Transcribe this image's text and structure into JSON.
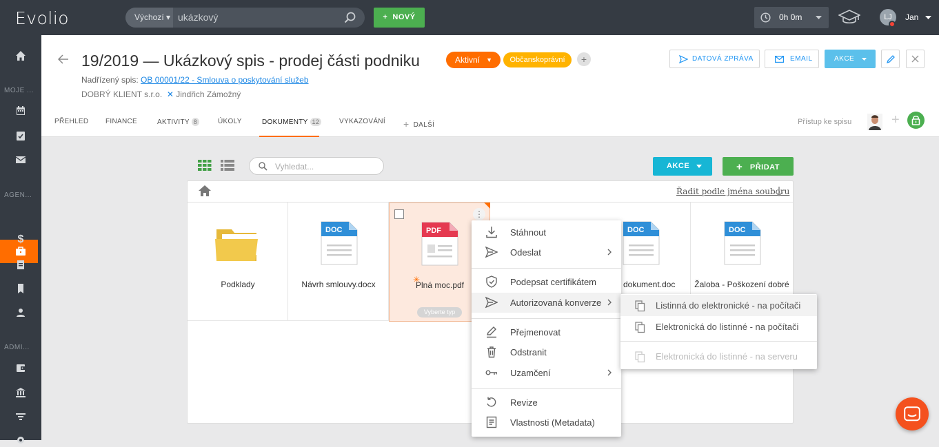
{
  "topbar": {
    "logo": "Evolio",
    "search_scope": "Výchozí",
    "search_value": "ukázkový",
    "new_button": "NOVÝ",
    "timer": "0h 0m",
    "user_initials": "LJ",
    "user_name": "Jan"
  },
  "sidebar": {
    "section_1": "MOJE ...",
    "section_2": "AGEN...",
    "section_3": "ADMI..."
  },
  "case": {
    "title": "19/2019 — Ukázkový spis - prodej části podniku",
    "status": "Aktivní",
    "type_tag": "Občanskoprávní",
    "add_tag": "+",
    "parent_label": "Nadřízený spis:",
    "parent_link": "OB 00001/22 - Smlouva o poskytování služeb",
    "client": "DOBRÝ KLIENT s.r.o.",
    "counterparty": "Jindřich Zámožný"
  },
  "header_buttons": {
    "datova_zprava": "DATOVÁ ZPRÁVA",
    "email": "EMAIL",
    "akce": "AKCE"
  },
  "tabs": {
    "prehled": "PŘEHLED",
    "finance": "FINANCE",
    "aktivity": "AKTIVITY",
    "aktivity_count": "8",
    "ukoly": "ÚKOLY",
    "dokumenty": "DOKUMENTY",
    "dokumenty_count": "12",
    "vykazovani": "VYKAZOVÁNÍ",
    "dalsi": "DALŠÍ",
    "access": "Přístup ke spisu"
  },
  "toolbar": {
    "search_placeholder": "Vyhledat...",
    "akce": "AKCE",
    "pridat": "PŘIDAT",
    "sort_label": "Řadit podle jména souboru"
  },
  "files": [
    {
      "name": "Podklady",
      "type": "folder"
    },
    {
      "name": "Návrh smlouvy.docx",
      "type": "DOC"
    },
    {
      "name": "Plná moc.pdf",
      "type": "PDF",
      "badge": "Vyberte typ"
    },
    {
      "name": "vací dokument.doc",
      "type": "DOC"
    },
    {
      "name": "Žaloba - Poškození dobré",
      "type": "DOC"
    }
  ],
  "context_menu": {
    "items": [
      "Stáhnout",
      "Odeslat",
      "Podepsat certifikátem",
      "Autorizovaná konverze",
      "Přejmenovat",
      "Odstranit",
      "Uzamčení",
      "Revize",
      "Vlastnosti (Metadata)"
    ]
  },
  "submenu": {
    "items": [
      "Listinná do elektronické - na počítači",
      "Elektronická do listinné - na počítači",
      "Elektronická do listinné - na serveru"
    ]
  },
  "colors": {
    "accent": "#ff6d00",
    "topbar": "#353b43",
    "green": "#4caf50",
    "cyan": "#17b6d5",
    "doc_blue": "#2f8fd8",
    "pdf_red": "#e53950",
    "folder": "#f2c94c"
  }
}
